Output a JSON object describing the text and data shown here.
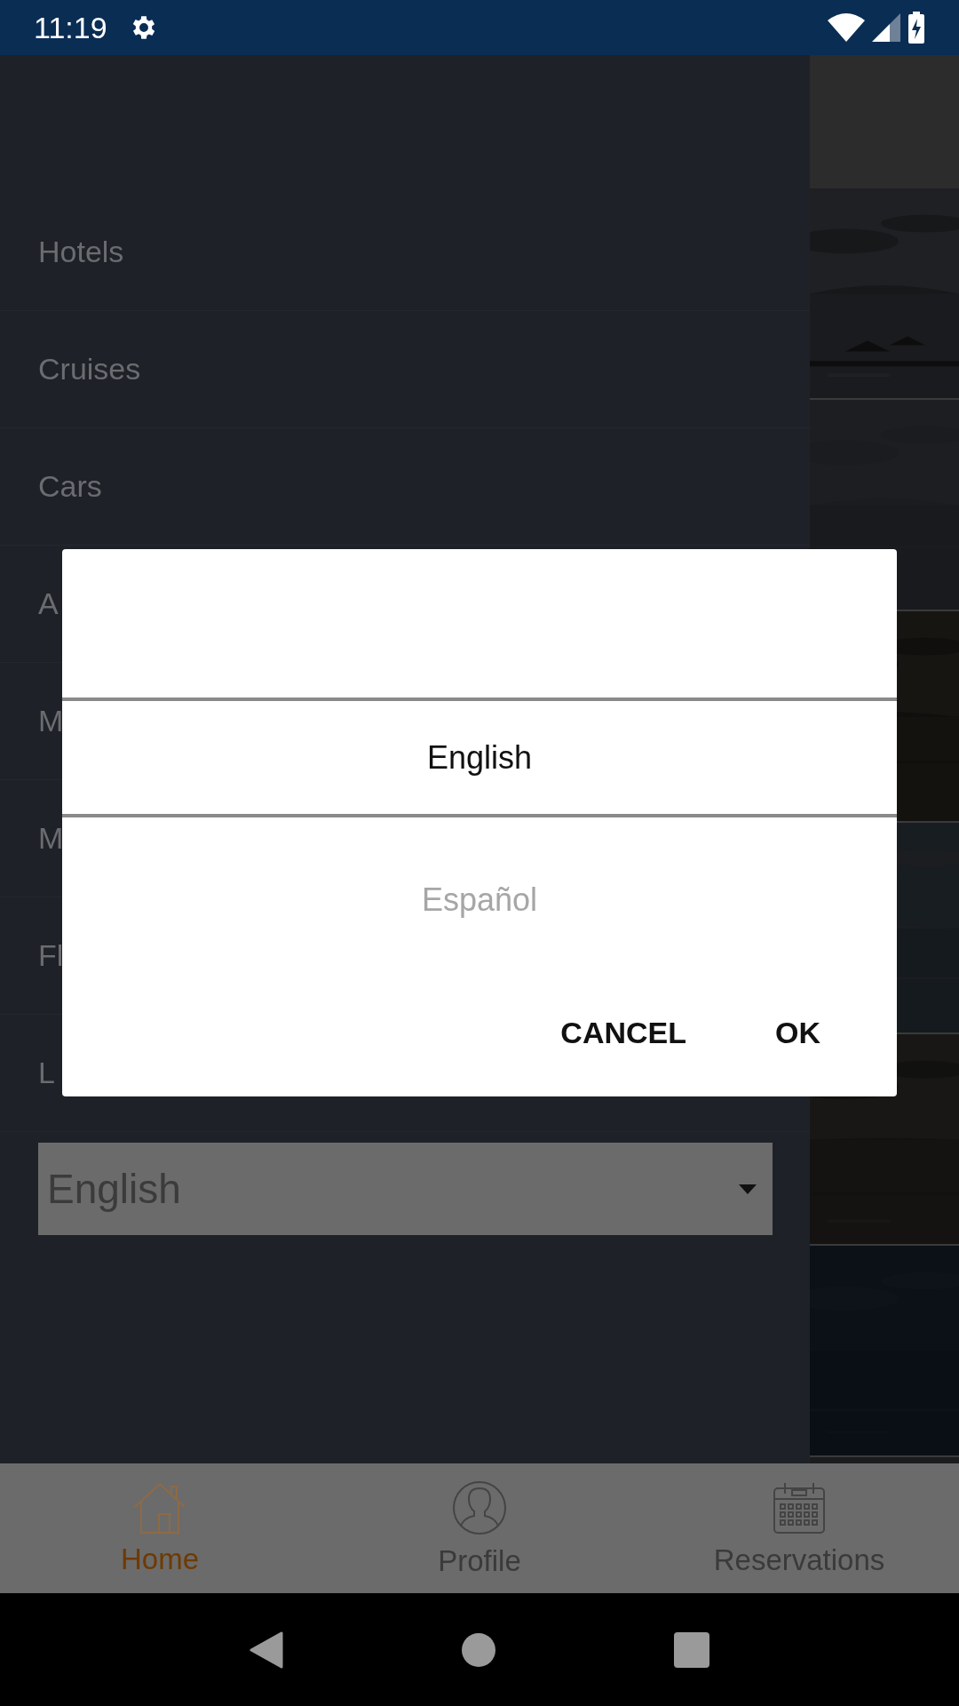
{
  "status_bar": {
    "time": "11:19"
  },
  "drawer": {
    "items": [
      {
        "label": "Hotels"
      },
      {
        "label": "Cruises"
      },
      {
        "label": "Cars"
      },
      {
        "label": "A"
      },
      {
        "label": "M"
      },
      {
        "label": "M"
      },
      {
        "label": "Fl"
      },
      {
        "label": "L"
      }
    ],
    "language_select": {
      "value": "English"
    }
  },
  "dialog": {
    "options": [
      {
        "label": "English",
        "selected": true
      },
      {
        "label": "Español",
        "selected": false
      }
    ],
    "buttons": [
      "CANCEL",
      "OK"
    ]
  },
  "bottom_nav": [
    {
      "label": "Home",
      "selected": true
    },
    {
      "label": "Profile",
      "selected": false
    },
    {
      "label": "Reservations",
      "selected": false
    }
  ]
}
